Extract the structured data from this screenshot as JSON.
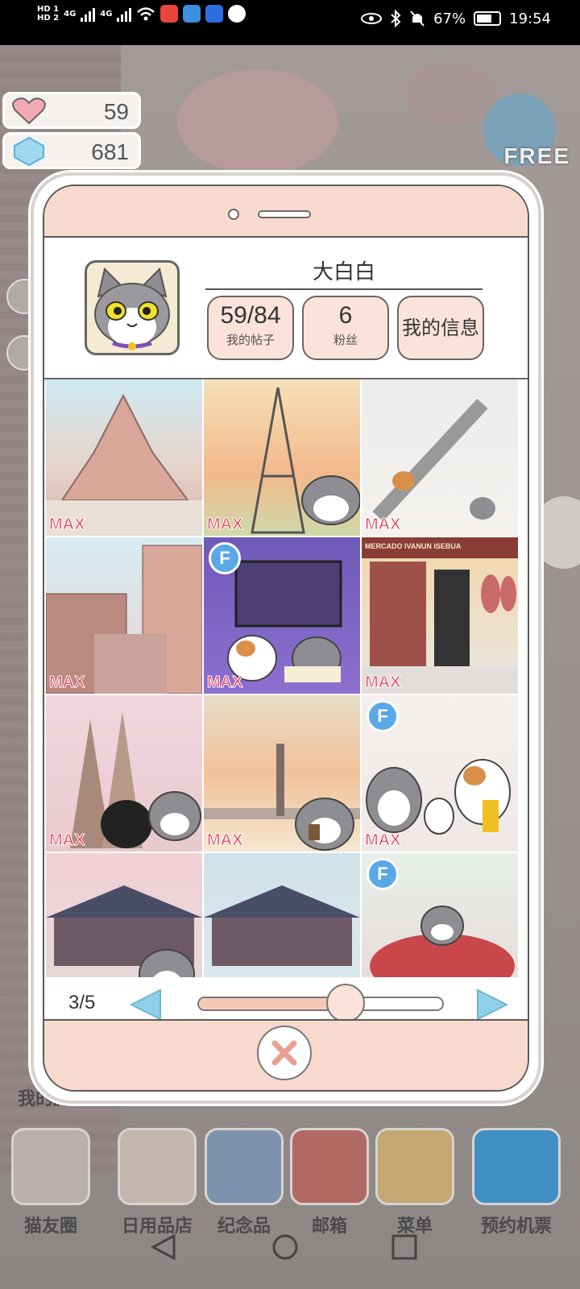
{
  "status_bar": {
    "hd1": "HD 1",
    "hd2": "HD 2",
    "net1": "4G",
    "net2": "4G",
    "battery": "67%",
    "time": "19:54"
  },
  "currencies": {
    "hearts": "59",
    "gems": "681"
  },
  "free_badge": "FREE",
  "profile": {
    "username": "大白白",
    "posts_value": "59/84",
    "posts_label": "我的帖子",
    "fans_value": "6",
    "fans_label": "粉丝",
    "messages_label": "我的信息"
  },
  "photos": [
    {
      "scene": "mont-saint-michel",
      "badge": "MAX"
    },
    {
      "scene": "eiffel-tower",
      "badge": "MAX"
    },
    {
      "scene": "escalator",
      "badge": "MAX"
    },
    {
      "scene": "apartments",
      "badge": "MAX"
    },
    {
      "scene": "karaoke",
      "badge": "MAX",
      "friend": "F"
    },
    {
      "scene": "ham-shop",
      "badge": "MAX",
      "shop_sign": "MERCADO IVANUN ISEBUA"
    },
    {
      "scene": "sagrada-familia",
      "badge": "MAX"
    },
    {
      "scene": "city-skyline",
      "badge": "MAX"
    },
    {
      "scene": "lucky-cats",
      "badge": "MAX",
      "friend": "F"
    },
    {
      "scene": "palace-1",
      "badge": ""
    },
    {
      "scene": "palace-2",
      "badge": ""
    },
    {
      "scene": "motorbike",
      "badge": "",
      "friend": "F"
    }
  ],
  "pager": {
    "indicator": "3/5",
    "progress": 0.6
  },
  "dock": {
    "items": [
      "猫友圈",
      "日用品店",
      "纪念品",
      "邮箱",
      "菜单",
      "预约机票"
    ],
    "partial_label": "我的房"
  },
  "colors": {
    "bezel": "#f7d9cd",
    "max_text": "#e0425a",
    "friend_badge": "#5aa8e8",
    "arrow": "#8fd0e8"
  }
}
